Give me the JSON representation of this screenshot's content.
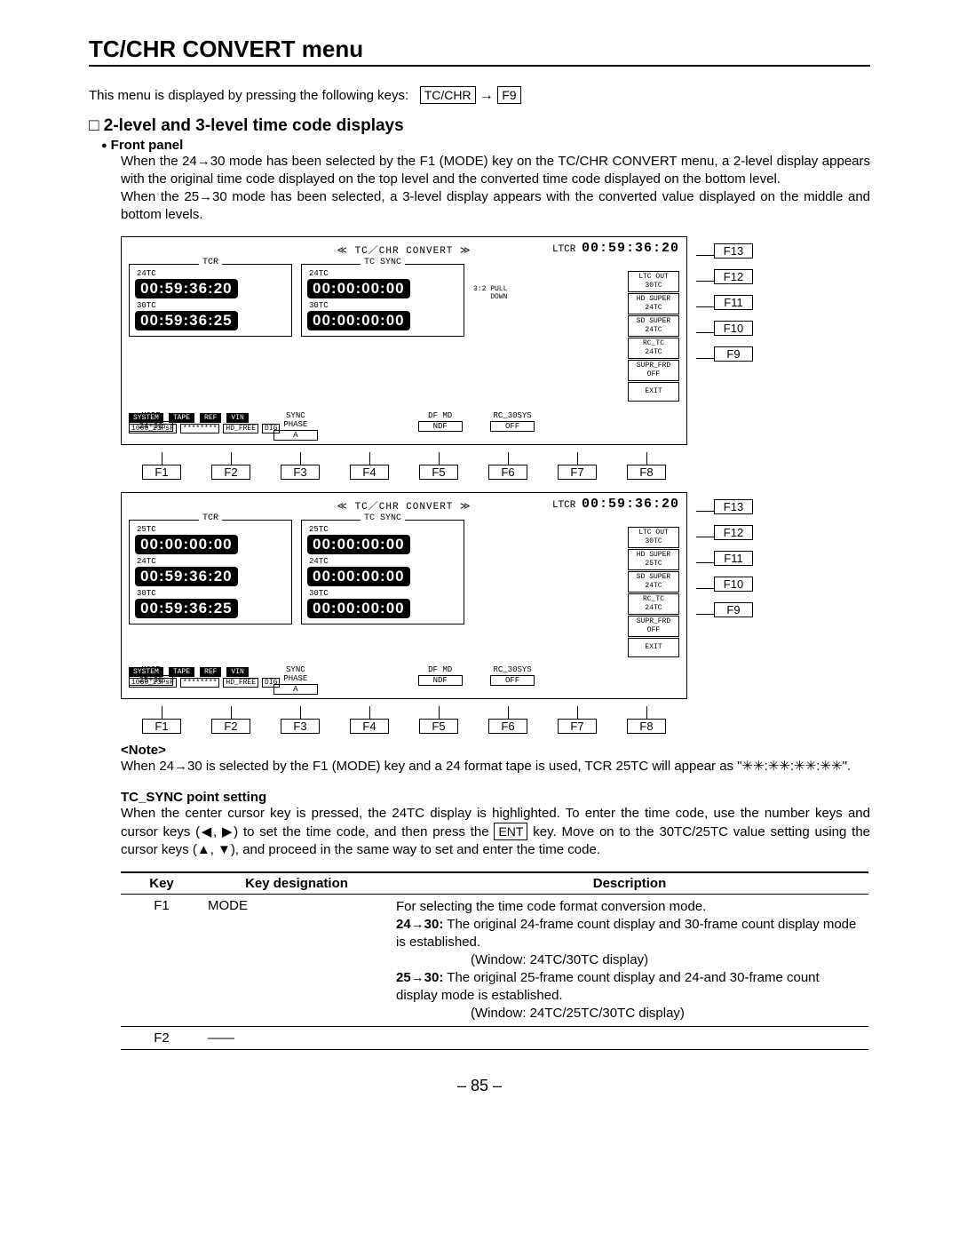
{
  "title": "TC/CHR CONVERT menu",
  "intro_prefix": "This menu is displayed by pressing the following keys:",
  "key1": "TC/CHR",
  "key2": "F9",
  "section_heading": "2-level and 3-level time code displays",
  "section_sq": "□ ",
  "front_panel_label": "Front panel",
  "front_panel_p1": "When the 24→30 mode has been selected by the F1 (MODE) key on the TC/CHR CONVERT menu, a 2-level display appears with the original time code displayed on the top level and the converted time code displayed on the bottom level.",
  "front_panel_p2": "When the 25→30 mode has been selected, a 3-level display appears with the converted value displayed on the middle and bottom levels.",
  "screen_common": {
    "title": "≪ TC／CHR  CONVERT ≫",
    "ltcr_label": "LTCR",
    "ltcr_value": "00:59:36:20",
    "tcr_legend": "TCR",
    "tcsync_legend": "TC SYNC",
    "pull_label1": "3:2 PULL",
    "pull_label2": "DOWN",
    "cells": [
      {
        "top": "LTC OUT",
        "bot": "30TC"
      },
      {
        "top": "HD SUPER",
        "bot": "24TC"
      },
      {
        "top": "SD SUPER",
        "bot": "24TC"
      },
      {
        "top": "RC_TC",
        "bot": "24TC"
      },
      {
        "top": "SUPR_FRD",
        "bot": "OFF"
      }
    ],
    "exit": "EXIT",
    "bottom_hdr": [
      "MODE",
      "",
      "SYNC PHASE",
      "",
      "DF MD",
      "RC_30SYS",
      "",
      ""
    ],
    "bottom_val": [
      "",
      "",
      "A",
      "",
      "NDF",
      "OFF",
      "",
      ""
    ],
    "status_black": [
      "SYSTEM",
      "TAPE",
      "REF",
      "VIN"
    ],
    "status_line2": [
      "1080_23PsF",
      "********",
      "HD_FREE",
      "DIG"
    ]
  },
  "screen1": {
    "tcr": [
      {
        "lbl": "24TC",
        "val": "00:59:36:20"
      },
      {
        "lbl": "30TC",
        "val": "00:59:36:25"
      }
    ],
    "sync": [
      {
        "lbl": "24TC",
        "val": "00:00:00:00"
      },
      {
        "lbl": "30TC",
        "val": "00:00:00:00"
      }
    ],
    "mode_val": "24+30"
  },
  "screen2": {
    "tcr": [
      {
        "lbl": "25TC",
        "val": "00:00:00:00"
      },
      {
        "lbl": "24TC",
        "val": "00:59:36:20"
      },
      {
        "lbl": "30TC",
        "val": "00:59:36:25"
      }
    ],
    "sync": [
      {
        "lbl": "25TC",
        "val": "00:00:00:00"
      },
      {
        "lbl": "24TC",
        "val": "00:00:00:00"
      },
      {
        "lbl": "30TC",
        "val": "00:00:00:00"
      }
    ],
    "cells": [
      {
        "top": "LTC OUT",
        "bot": "30TC"
      },
      {
        "top": "HD SUPER",
        "bot": "25TC"
      },
      {
        "top": "SD SUPER",
        "bot": "24TC"
      },
      {
        "top": "RC_TC",
        "bot": "24TC"
      },
      {
        "top": "SUPR_FRD",
        "bot": "OFF"
      }
    ],
    "mode_val": "25+30"
  },
  "side_fkeys": [
    "F13",
    "F12",
    "F11",
    "F10",
    "F9"
  ],
  "bottom_fkeys": [
    "F1",
    "F2",
    "F3",
    "F4",
    "F5",
    "F6",
    "F7",
    "F8"
  ],
  "note_label": "<Note>",
  "note_text": "When 24→30 is selected by the F1 (MODE) key and a 24 format tape is used, TCR 25TC will appear as \"✳✳:✳✳:✳✳:✳✳\".",
  "tcsync_head": "TC_SYNC point setting",
  "tcsync_p_a": "When the center cursor key is pressed, the 24TC display is highlighted.  To enter the time code, use the number keys and cursor keys (◀, ▶) to set the time code, and then press the ",
  "tcsync_ent": "ENT",
  "tcsync_p_b": " key.  Move on to the 30TC/25TC value setting using the cursor keys (▲, ▼), and proceed in the same way to set and enter the time code.",
  "table": {
    "h1": "Key",
    "h2": "Key designation",
    "h3": "Description",
    "rows": [
      {
        "key": "F1",
        "desig": "MODE",
        "desc_first": "For selecting the time code format conversion mode.",
        "mode1_lbl": "24→30:",
        "mode1_txt": "The original 24-frame count display and 30-frame count display mode is established.",
        "mode1_win": "(Window: 24TC/30TC display)",
        "mode2_lbl": "25→30:",
        "mode2_txt": "The original 25-frame count display and 24-and 30-frame count display mode is established.",
        "mode2_win": "(Window: 24TC/25TC/30TC display)"
      },
      {
        "key": "F2",
        "desig": "——",
        "desc_first": ""
      }
    ]
  },
  "page_number": "– 85 –"
}
